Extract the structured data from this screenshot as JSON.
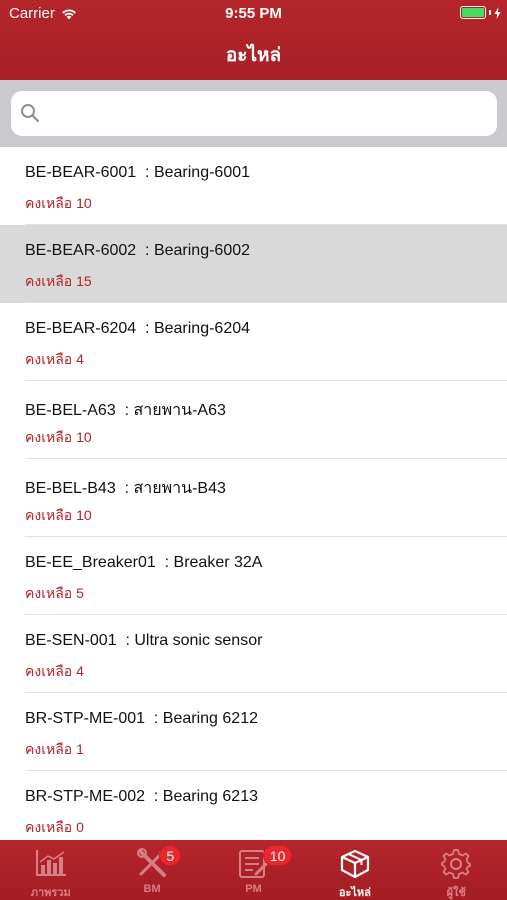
{
  "status": {
    "carrier": "Carrier",
    "time": "9:55 PM"
  },
  "header": {
    "title": "อะไหล่"
  },
  "search": {
    "placeholder": "",
    "value": ""
  },
  "colors": {
    "brand": "#aa2228",
    "remain_text": "#b0262b",
    "battery": "#4cd964",
    "badge": "#e8282e"
  },
  "items": [
    {
      "name": "BE-BEAR-6001  : Bearing-6001",
      "remain": "คงเหลือ 10",
      "selected": false
    },
    {
      "name": "BE-BEAR-6002  : Bearing-6002",
      "remain": "คงเหลือ 15",
      "selected": true
    },
    {
      "name": "BE-BEAR-6204  : Bearing-6204",
      "remain": "คงเหลือ 4",
      "selected": false
    },
    {
      "name": "BE-BEL-A63  : สายพาน-A63",
      "remain": "คงเหลือ 10",
      "selected": false
    },
    {
      "name": "BE-BEL-B43  : สายพาน-B43",
      "remain": "คงเหลือ 10",
      "selected": false
    },
    {
      "name": "BE-EE_Breaker01  : Breaker 32A",
      "remain": "คงเหลือ 5",
      "selected": false
    },
    {
      "name": "BE-SEN-001  : Ultra sonic sensor",
      "remain": "คงเหลือ 4",
      "selected": false
    },
    {
      "name": "BR-STP-ME-001  : Bearing 6212",
      "remain": "คงเหลือ 1",
      "selected": false
    },
    {
      "name": "BR-STP-ME-002  : Bearing 6213",
      "remain": "คงเหลือ 0",
      "selected": false
    }
  ],
  "tabs": [
    {
      "label": "ภาพรวม",
      "icon": "chart-icon",
      "badge": "",
      "active": false
    },
    {
      "label": "BM",
      "icon": "tools-icon",
      "badge": "5",
      "active": false
    },
    {
      "label": "PM",
      "icon": "checklist-icon",
      "badge": "10",
      "active": false
    },
    {
      "label": "อะไหล่",
      "icon": "box-icon",
      "badge": "",
      "active": true
    },
    {
      "label": "ผู้ใช้",
      "icon": "gear-icon",
      "badge": "",
      "active": false
    }
  ]
}
